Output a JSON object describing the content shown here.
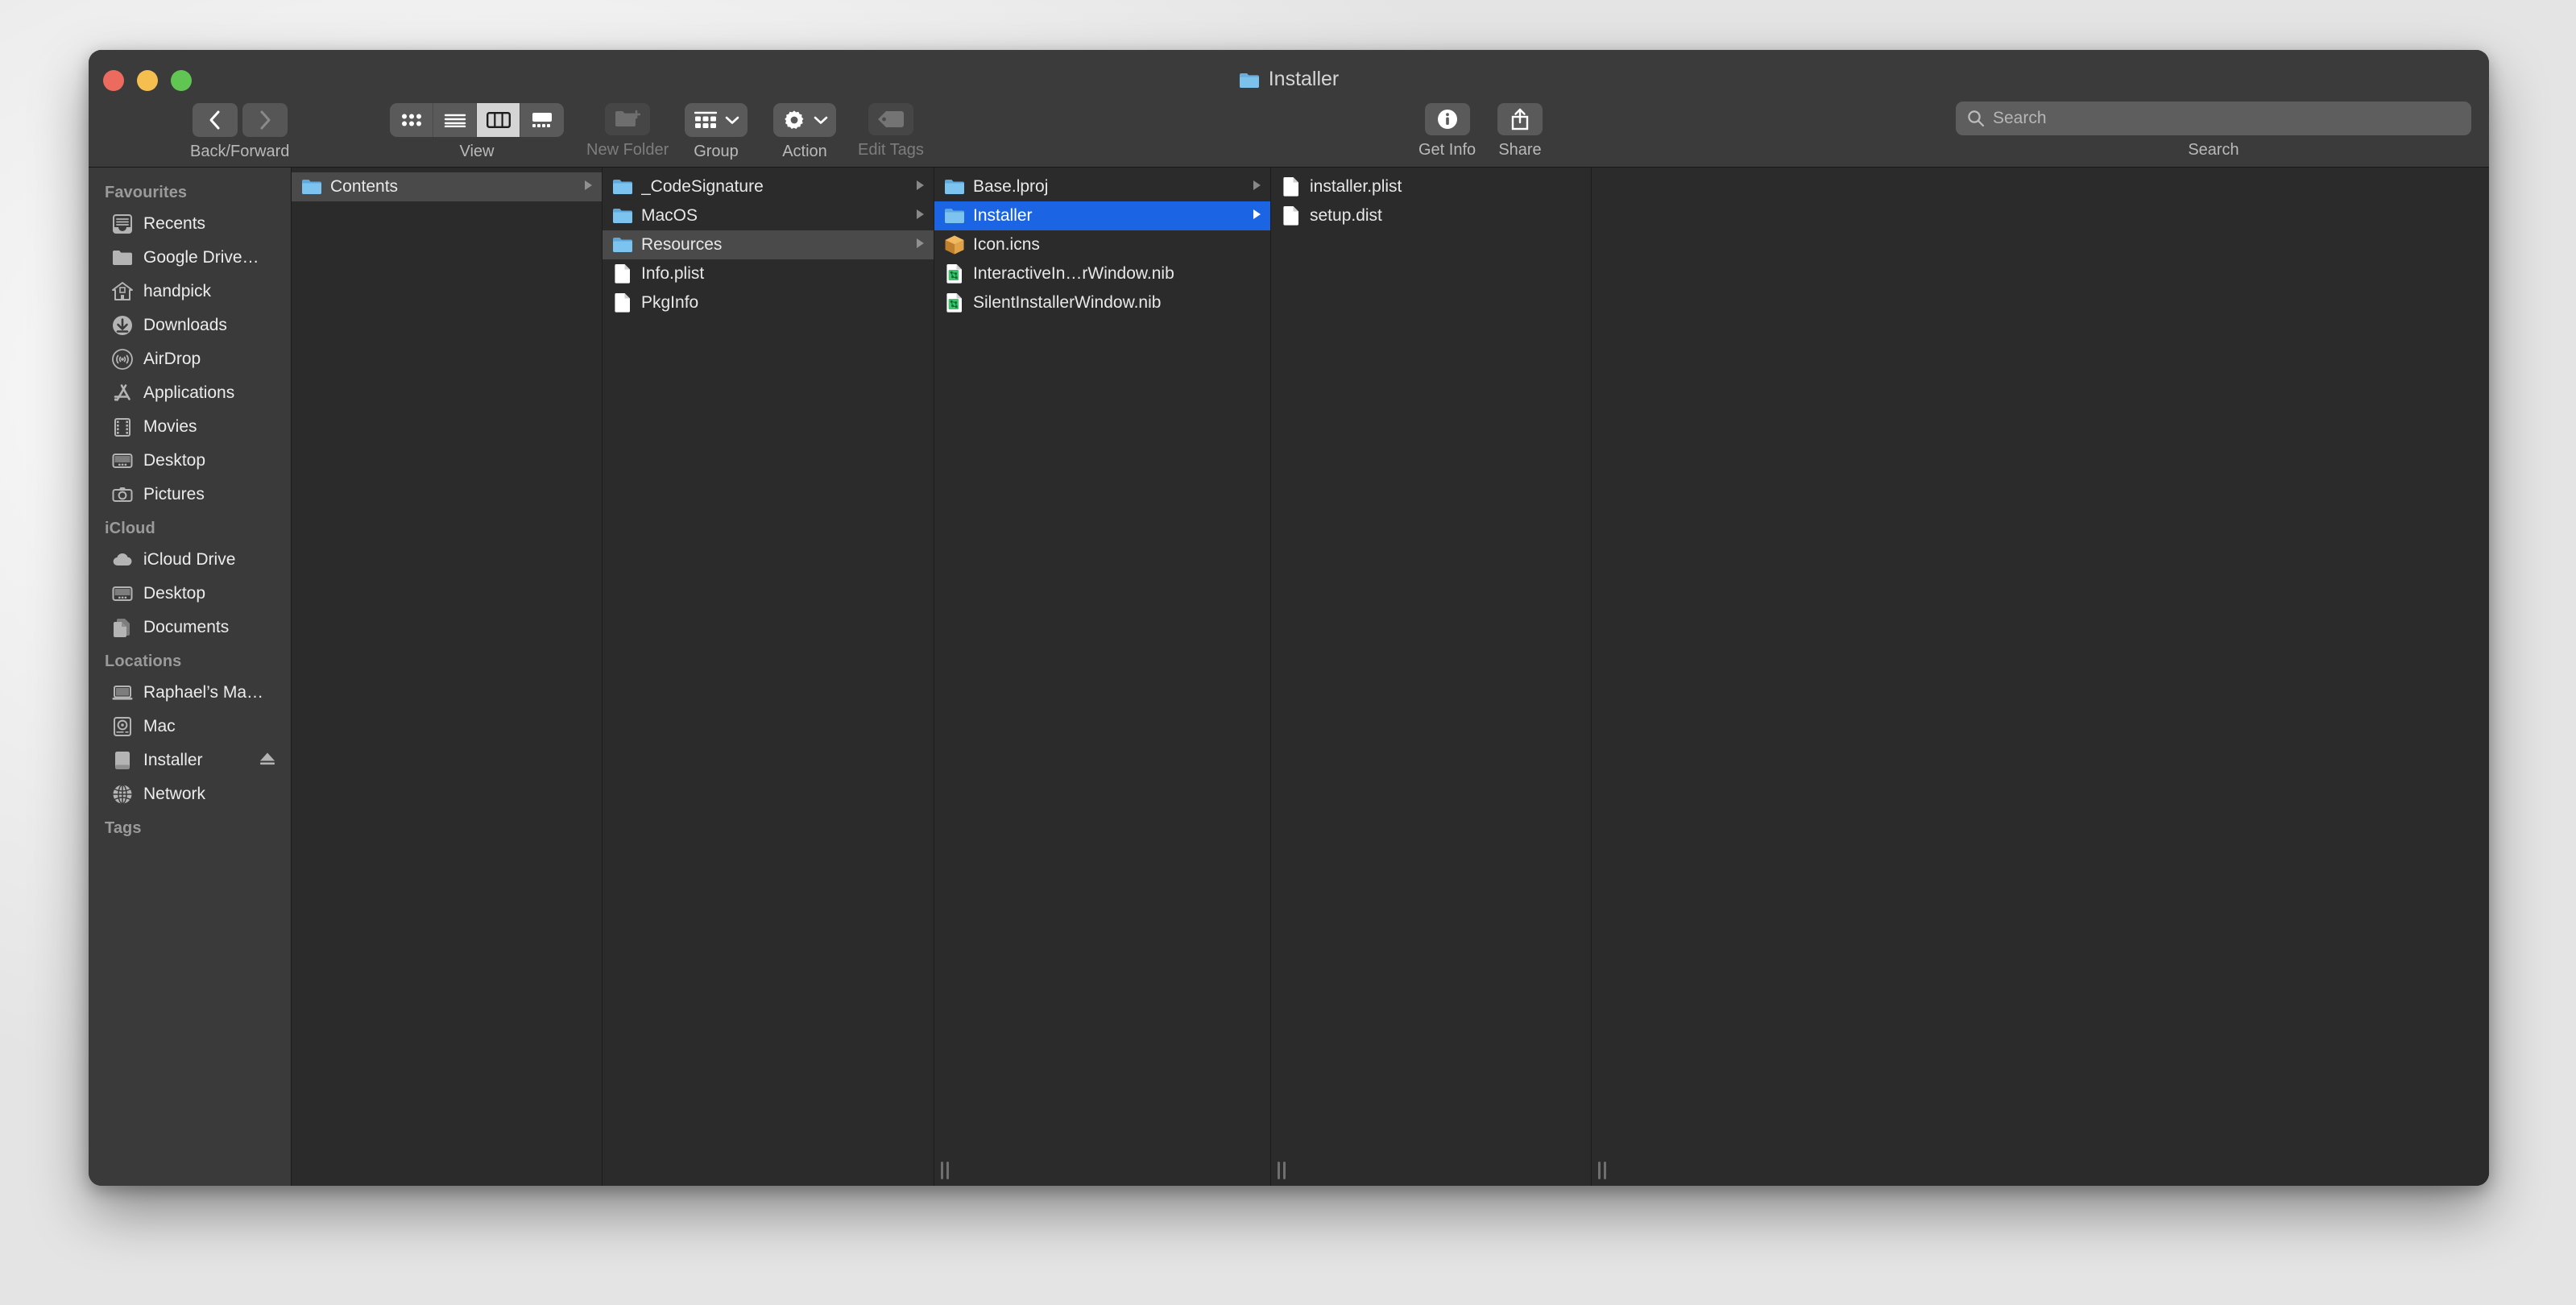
{
  "window": {
    "title": "Installer",
    "title_icon": "folder-icon",
    "traffic_lights": [
      {
        "name": "close",
        "color": "#ed6a5f"
      },
      {
        "name": "minimize",
        "color": "#f4bf4f"
      },
      {
        "name": "maximize",
        "color": "#61c554"
      }
    ]
  },
  "toolbar": {
    "back_forward_label": "Back/Forward",
    "back_icon": "chevron-left-icon",
    "forward_icon": "chevron-right-icon",
    "view_label": "View",
    "view_options": [
      {
        "name": "icon-view",
        "icon": "grid-icon",
        "selected": false
      },
      {
        "name": "list-view",
        "icon": "list-icon",
        "selected": false
      },
      {
        "name": "column-view",
        "icon": "columns-icon",
        "selected": true
      },
      {
        "name": "gallery-view",
        "icon": "gallery-icon",
        "selected": false
      }
    ],
    "new_folder_label": "New Folder",
    "new_folder_icon": "new-folder-icon",
    "new_folder_disabled": true,
    "group_label": "Group",
    "group_icon": "group-icon",
    "action_label": "Action",
    "action_icon": "gear-icon",
    "edit_tags_label": "Edit Tags",
    "edit_tags_icon": "tag-icon",
    "edit_tags_disabled": true,
    "get_info_label": "Get Info",
    "get_info_icon": "info-icon",
    "share_label": "Share",
    "share_icon": "share-icon",
    "search_label": "Search",
    "search_placeholder": "Search",
    "search_value": "",
    "search_icon": "search-icon"
  },
  "sidebar": {
    "sections": [
      {
        "header": "Favourites",
        "items": [
          {
            "label": "Recents",
            "icon": "recents-icon"
          },
          {
            "label": "Google Drive…",
            "icon": "folder-plain-icon"
          },
          {
            "label": "handpick",
            "icon": "home-icon"
          },
          {
            "label": "Downloads",
            "icon": "downloads-icon"
          },
          {
            "label": "AirDrop",
            "icon": "airdrop-icon"
          },
          {
            "label": "Applications",
            "icon": "applications-icon"
          },
          {
            "label": "Movies",
            "icon": "movies-icon"
          },
          {
            "label": "Desktop",
            "icon": "desktop-icon"
          },
          {
            "label": "Pictures",
            "icon": "pictures-icon"
          }
        ]
      },
      {
        "header": "iCloud",
        "items": [
          {
            "label": "iCloud Drive",
            "icon": "cloud-icon"
          },
          {
            "label": "Desktop",
            "icon": "desktop-icon"
          },
          {
            "label": "Documents",
            "icon": "documents-icon"
          }
        ]
      },
      {
        "header": "Locations",
        "items": [
          {
            "label": "Raphael’s Ma…",
            "icon": "laptop-icon"
          },
          {
            "label": "Mac",
            "icon": "harddisk-icon"
          },
          {
            "label": "Installer",
            "icon": "volume-icon",
            "eject": true,
            "eject_icon": "eject-icon"
          },
          {
            "label": "Network",
            "icon": "network-icon"
          }
        ]
      },
      {
        "header": "Tags",
        "items": []
      }
    ]
  },
  "columns": [
    {
      "name": "column-1",
      "has_grip": false,
      "rows": [
        {
          "label": "Contents",
          "icon": "folder-icon",
          "chevron": true,
          "selection": "inactive"
        }
      ]
    },
    {
      "name": "column-2",
      "has_grip": false,
      "rows": [
        {
          "label": "_CodeSignature",
          "icon": "folder-icon",
          "chevron": true,
          "selection": "none"
        },
        {
          "label": "MacOS",
          "icon": "folder-icon",
          "chevron": true,
          "selection": "none"
        },
        {
          "label": "Resources",
          "icon": "folder-icon",
          "chevron": true,
          "selection": "inactive"
        },
        {
          "label": "Info.plist",
          "icon": "document-icon",
          "chevron": false,
          "selection": "none"
        },
        {
          "label": "PkgInfo",
          "icon": "document-icon",
          "chevron": false,
          "selection": "none"
        }
      ]
    },
    {
      "name": "column-3",
      "has_grip": true,
      "rows": [
        {
          "label": "Base.lproj",
          "icon": "folder-icon",
          "chevron": true,
          "selection": "none"
        },
        {
          "label": "Installer",
          "icon": "folder-icon",
          "chevron": true,
          "selection": "active"
        },
        {
          "label": "Icon.icns",
          "icon": "icns-package-icon",
          "chevron": false,
          "selection": "none"
        },
        {
          "label": "InteractiveIn…rWindow.nib",
          "icon": "nib-icon",
          "chevron": false,
          "selection": "none"
        },
        {
          "label": "SilentInstallerWindow.nib",
          "icon": "nib-icon",
          "chevron": false,
          "selection": "none"
        }
      ]
    },
    {
      "name": "column-4",
      "has_grip": true,
      "rows": [
        {
          "label": "installer.plist",
          "icon": "document-icon",
          "chevron": false,
          "selection": "none"
        },
        {
          "label": "setup.dist",
          "icon": "document-icon",
          "chevron": false,
          "selection": "none"
        }
      ]
    },
    {
      "name": "column-5",
      "has_grip": true,
      "rows": []
    }
  ],
  "colors": {
    "selection_active": "#1b64e3",
    "selection_inactive": "#4a4a4a",
    "folder_blue": "#70b8e8",
    "window_bg": "#2b2b2b",
    "sidebar_bg": "#3a3a3a",
    "toolbar_bg": "#3b3b3b"
  }
}
